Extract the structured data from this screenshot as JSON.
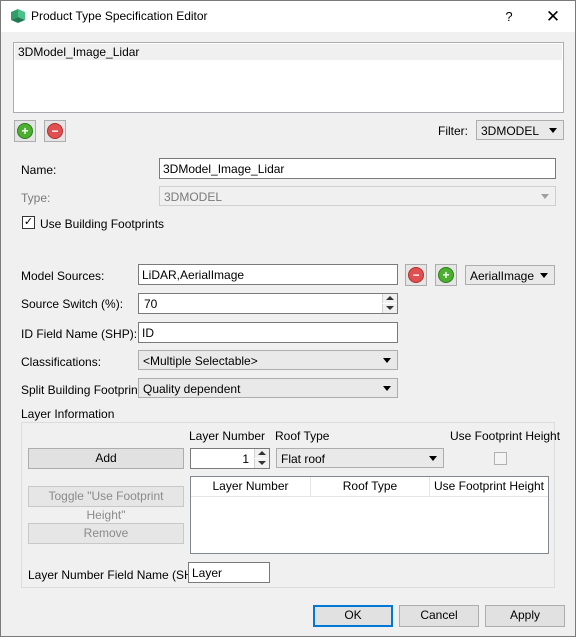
{
  "window": {
    "title": "Product Type Specification Editor",
    "help": "?",
    "close": "✕"
  },
  "spec_list": {
    "items": [
      "3DModel_Image_Lidar"
    ]
  },
  "filter": {
    "label": "Filter:",
    "value": "3DMODEL"
  },
  "name": {
    "label": "Name:",
    "value": "3DModel_Image_Lidar"
  },
  "type": {
    "label": "Type:",
    "value": "3DMODEL"
  },
  "use_building_footprints": {
    "label": "Use Building Footprints",
    "checked": true,
    "mark": "✓"
  },
  "model_sources": {
    "label": "Model Sources:",
    "value": "LiDAR,AerialImage",
    "combo_value": "AerialImage"
  },
  "source_switch": {
    "label": "Source Switch (%):",
    "value": "70"
  },
  "id_field": {
    "label": "ID Field Name (SHP):",
    "value": "ID"
  },
  "classifications": {
    "label": "Classifications:",
    "value": "<Multiple Selectable>"
  },
  "split_footprints": {
    "label": "Split Building Footprints",
    "value": "Quality dependent"
  },
  "layer_info": {
    "title": "Layer Information",
    "layer_number_label": "Layer Number",
    "roof_type_label": "Roof Type",
    "use_footprint_height_label": "Use Footprint Height",
    "add_label": "Add",
    "layer_number_value": "1",
    "roof_type_value": "Flat roof",
    "toggle_label": "Toggle \"Use Footprint Height\"",
    "remove_label": "Remove",
    "table_columns": [
      "Layer Number",
      "Roof Type",
      "Use Footprint Height"
    ],
    "layer_field_label": "Layer Number Field Name (SHP):",
    "layer_field_value": "Layer"
  },
  "buttons": {
    "ok": "OK",
    "cancel": "Cancel",
    "apply": "Apply"
  },
  "icons": {
    "add": "add-icon",
    "remove": "remove-icon",
    "app": "app-icon"
  },
  "colors": {
    "accent": "#0078d7",
    "add_green": "#4caf2f",
    "remove_red": "#e05050"
  }
}
